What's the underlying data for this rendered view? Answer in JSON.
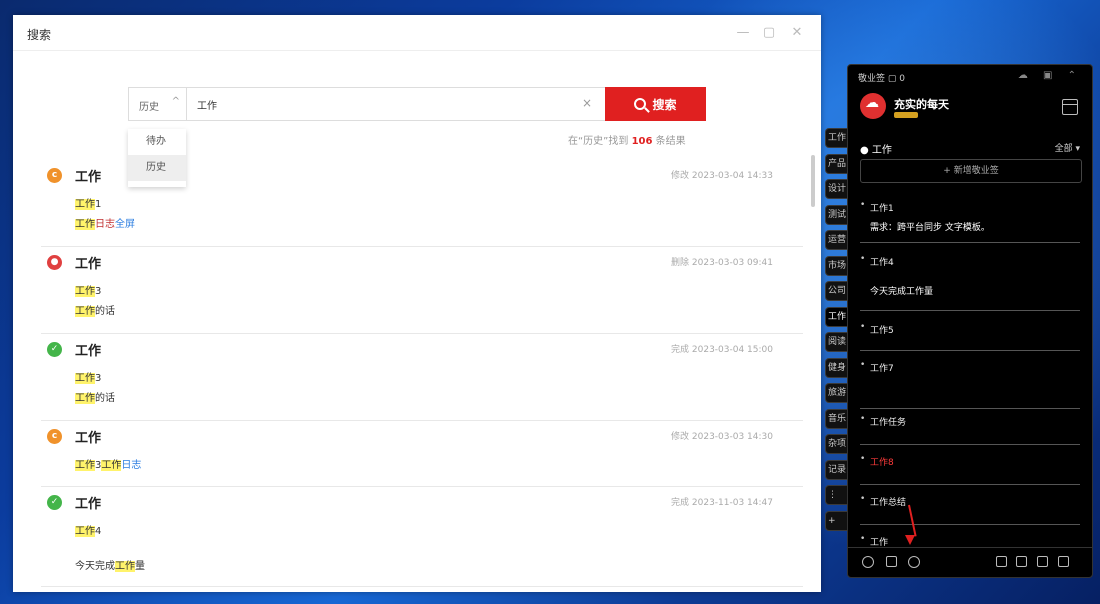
{
  "window": {
    "title": "搜索",
    "minimize": "—",
    "maximize": "▢",
    "close": "✕"
  },
  "search": {
    "scope_label": "历史",
    "scope_caret": "^",
    "query": "工作",
    "clear": "×",
    "button_label": "搜索",
    "scope_options": [
      "待办",
      "历史"
    ],
    "result_prefix": "在“历史”找到",
    "result_count": "106",
    "result_suffix": "条结果"
  },
  "results": [
    {
      "status": "orange",
      "status_glyph": "c",
      "title": "工作",
      "time": "修改 2023-03-04 14:33",
      "lines": [
        {
          "parts": [
            {
              "t": "工作",
              "mk": true
            },
            {
              "t": "1"
            }
          ]
        },
        {
          "parts": [
            {
              "t": "工作",
              "mk": true
            },
            {
              "t": "日志",
              "red": true
            },
            {
              "t": "全屏",
              "blue": true
            }
          ]
        }
      ]
    },
    {
      "status": "red",
      "status_glyph": "●",
      "title": "工作",
      "time": "删除 2023-03-03 09:41",
      "lines": [
        {
          "parts": [
            {
              "t": "工作",
              "mk": true
            },
            {
              "t": "3"
            }
          ]
        },
        {
          "parts": [
            {
              "t": "工作",
              "mk": true
            },
            {
              "t": "的话"
            }
          ]
        }
      ]
    },
    {
      "status": "green",
      "status_glyph": "✓",
      "title": "工作",
      "time": "完成 2023-03-04 15:00",
      "lines": [
        {
          "parts": [
            {
              "t": "工作",
              "mk": true
            },
            {
              "t": "3"
            }
          ]
        },
        {
          "parts": [
            {
              "t": "工作",
              "mk": true
            },
            {
              "t": "的话"
            }
          ]
        }
      ]
    },
    {
      "status": "orange",
      "status_glyph": "c",
      "title": "工作",
      "time": "修改 2023-03-03 14:30",
      "lines": [
        {
          "parts": [
            {
              "t": "工作",
              "mk": true
            },
            {
              "t": "3"
            },
            {
              "t": "工作",
              "mk": true
            },
            {
              "t": "日志",
              "blue": true
            }
          ]
        }
      ]
    },
    {
      "status": "green",
      "status_glyph": "✓",
      "title": "工作",
      "time": "完成 2023-11-03 14:47",
      "lines": [
        {
          "parts": [
            {
              "t": "工作",
              "mk": true
            },
            {
              "t": "4"
            }
          ]
        },
        {
          "parts": [
            {
              "t": "今天完成"
            },
            {
              "t": "工作",
              "mk": true
            },
            {
              "t": "量"
            }
          ]
        }
      ]
    }
  ],
  "side_tabs": [
    "工作",
    "产品",
    "设计",
    "测试",
    "运营",
    "市场",
    "公司",
    "工作",
    "阅读",
    "健身",
    "旅游",
    "音乐",
    "杂项",
    "记录",
    "⋮",
    "+"
  ],
  "panel": {
    "top_label": "敬业签",
    "top_count": "0",
    "controls": "☁ ▣ ⌃",
    "user_name": "充实的每天",
    "group": "工作",
    "filter": "全部 ▾",
    "new_note": "+ 新增敬业签",
    "notes": [
      {
        "title": "工作1",
        "body": "需求：跨平台同步 文字模板。"
      },
      {
        "title": "工作4",
        "body": "今天完成工作量"
      },
      {
        "title": "工作5",
        "body": ""
      },
      {
        "title": "工作7",
        "body": ""
      },
      {
        "title": "工作任务",
        "body": ""
      },
      {
        "title": "工作8",
        "body": "",
        "red": true
      },
      {
        "title": "工作总结",
        "body": ""
      },
      {
        "title": "工作",
        "body": ""
      }
    ]
  },
  "colors": {
    "accent": "#e02020",
    "orange": "#f0922b",
    "red": "#e04040",
    "green": "#44b54a",
    "highlight": "#fff36b"
  }
}
